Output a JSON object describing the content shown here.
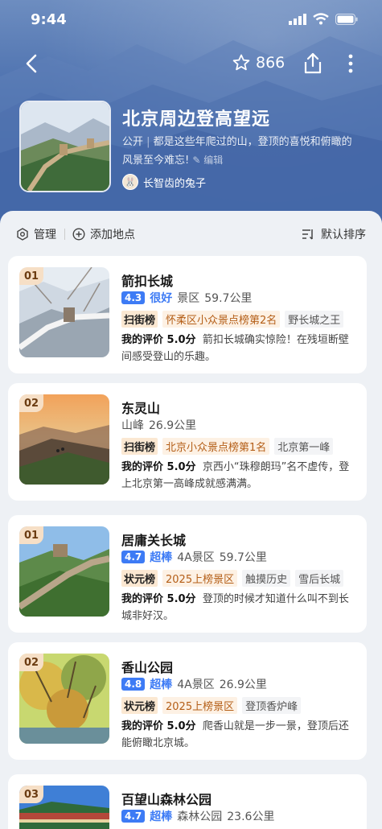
{
  "status_bar": {
    "time": "9:44"
  },
  "nav": {
    "favorite_count": "866"
  },
  "list": {
    "title": "北京周边登高望远",
    "visibility": "公开",
    "description": "都是这些年爬过的山，登顶的喜悦和俯瞰的风景至今难忘!",
    "edit_label": "编辑",
    "author": "长智齿的兔子"
  },
  "toolbar": {
    "manage": "管理",
    "add_place": "添加地点",
    "sort": "默认排序"
  },
  "places": [
    {
      "rank": "01",
      "name": "箭扣长城",
      "score": "4.3",
      "score_word": "很好",
      "category": "景区",
      "distance": "59.7公里",
      "grade": "",
      "rank_label": "扫街榜",
      "rank_text": "怀柔区小众景点榜第2名",
      "tag": "野长城之王",
      "review_label": "我的评价 5.0分",
      "review": "箭扣长城确实惊险！在残垣断壁间感受登山的乐趣。"
    },
    {
      "rank": "02",
      "name": "东灵山",
      "score": "",
      "score_word": "",
      "category": "山峰",
      "distance": "26.9公里",
      "grade": "",
      "rank_label": "扫街榜",
      "rank_text": "北京小众景点榜第1名",
      "tag": "北京第一峰",
      "review_label": "我的评价 5.0分",
      "review": "京西小“珠穆朗玛”名不虚传，登上北京第一高峰成就感满满。"
    },
    {
      "rank": "01",
      "name": "居庸关长城",
      "score": "4.7",
      "score_word": "超棒",
      "category": "",
      "grade": "4A景区",
      "distance": "59.7公里",
      "rank_label": "状元榜",
      "rank_text": "2025上榜景区",
      "tag": "触摸历史",
      "tag2": "雪后长城",
      "review_label": "我的评价 5.0分",
      "review": "登顶的时候才知道什么叫不到长城非好汉。"
    },
    {
      "rank": "02",
      "name": "香山公园",
      "score": "4.8",
      "score_word": "超棒",
      "category": "",
      "grade": "4A景区",
      "distance": "26.9公里",
      "rank_label": "状元榜",
      "rank_text": "2025上榜景区",
      "tag": "登顶香炉峰",
      "review_label": "我的评价 5.0分",
      "review": "爬香山就是一步一景，登顶后还能俯瞰北京城。"
    },
    {
      "rank": "03",
      "name": "百望山森林公园",
      "score": "4.7",
      "score_word": "超棒",
      "category": "森林公园",
      "distance": "23.6公里",
      "grade": ""
    }
  ],
  "colors": {
    "accent": "#3d7bf5",
    "header": "#3f66a8",
    "rank_text": "#b45e17"
  }
}
